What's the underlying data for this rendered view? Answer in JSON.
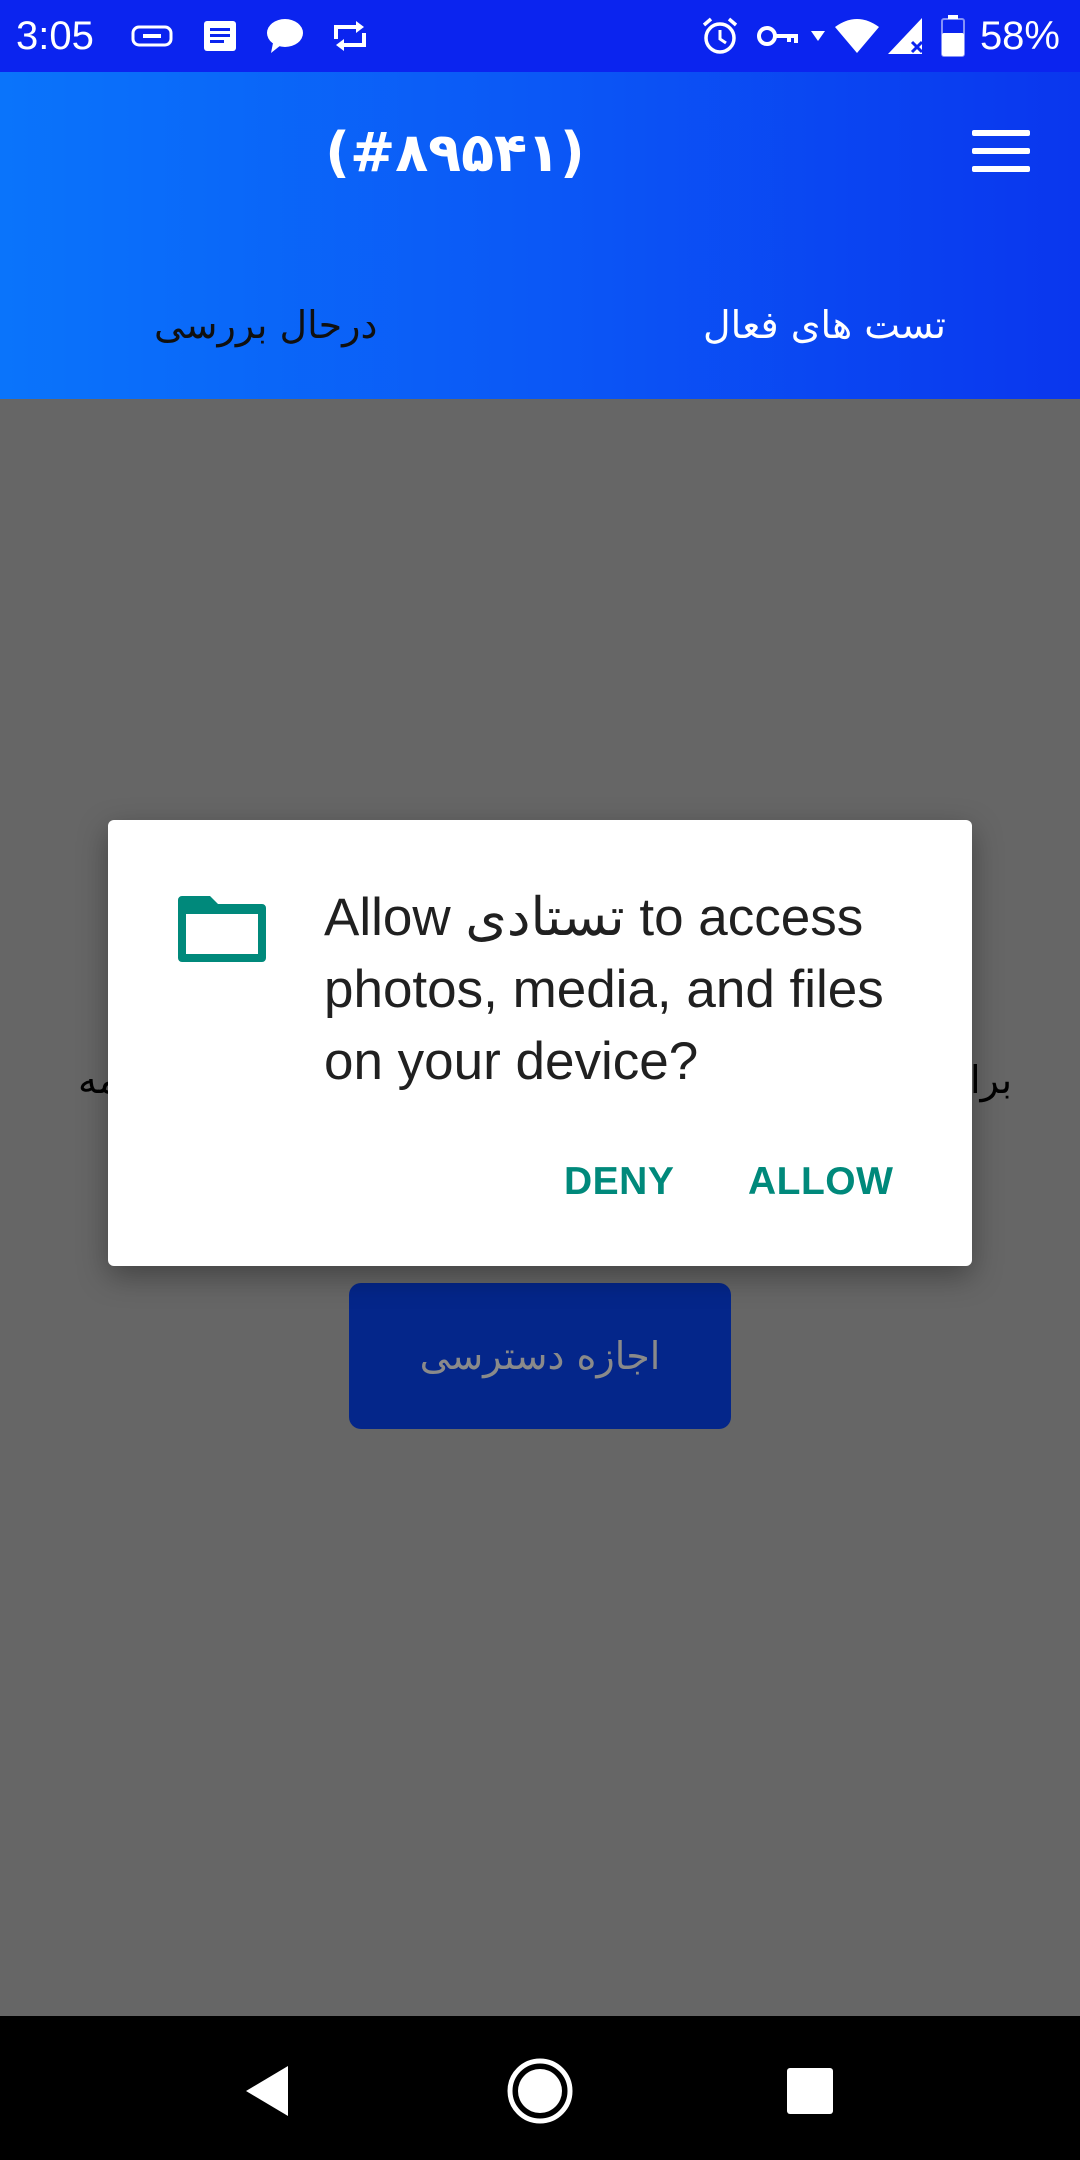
{
  "status_bar": {
    "time": "3:05",
    "battery_percent": "58%",
    "icons": [
      "sms-icon",
      "notes-icon",
      "chat-icon",
      "sync-icon",
      "alarm-icon",
      "vpn-key-icon",
      "wifi-icon",
      "signal-icon",
      "battery-icon"
    ]
  },
  "header": {
    "title": "(#۸۹۵۴۱)",
    "menu_icon": "hamburger-menu-icon"
  },
  "tabs": {
    "active": "تست های فعال",
    "review": "درحال بررسی"
  },
  "background": {
    "text_left_fragment": "مه",
    "text_right_fragment": "برا",
    "grant_button_label": "اجازه دسترسی"
  },
  "dialog": {
    "icon": "folder-icon",
    "message": "Allow تستادی to access photos, media, and files on your device?",
    "deny_label": "DENY",
    "allow_label": "ALLOW"
  },
  "nav_bar": {
    "icons": [
      "back-icon",
      "home-icon",
      "recents-icon"
    ]
  },
  "colors": {
    "status_bar": "#0b24ef",
    "header_gradient_start": "#0a74fb",
    "header_gradient_end": "#0a36ee",
    "scrim": "#666666",
    "dialog_accent": "#00897b",
    "grant_button": "#04268a"
  }
}
